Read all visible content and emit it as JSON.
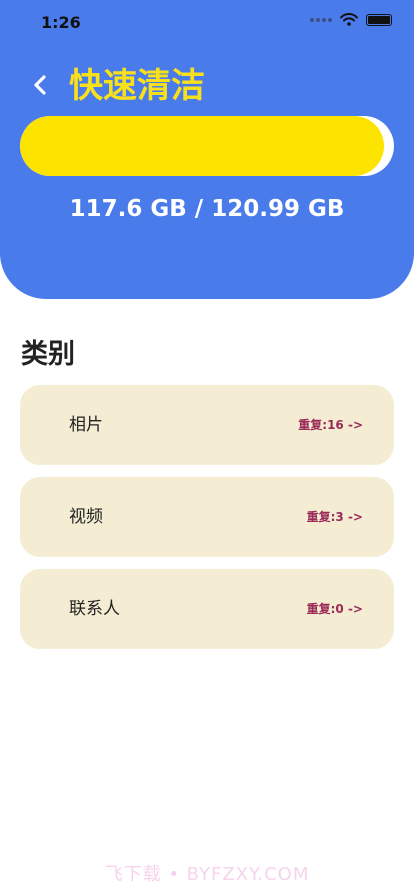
{
  "status_bar": {
    "time": "1:26"
  },
  "header": {
    "title": "快速清洁"
  },
  "storage": {
    "text": "117.6 GB / 120.99 GB",
    "used_fraction": 0.972
  },
  "categories": {
    "title": "类别",
    "items": [
      {
        "name": "相片",
        "duplicates": "重复:16 ->"
      },
      {
        "name": "视频",
        "duplicates": "重复:3 ->"
      },
      {
        "name": "联系人",
        "duplicates": "重复:0 ->"
      }
    ]
  },
  "watermark": "飞下载 • BYFZXY.COM",
  "colors": {
    "header_bg": "#4a7bea",
    "accent_yellow": "#fce300",
    "card_bg": "#f4edd3",
    "dup_text": "#9a2a58"
  }
}
